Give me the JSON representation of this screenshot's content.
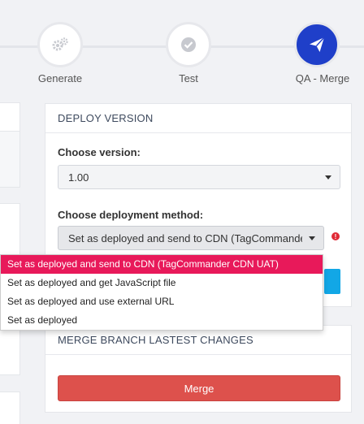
{
  "stepper": {
    "steps": [
      {
        "label": "Generate",
        "icon": "gears-icon",
        "state": "done"
      },
      {
        "label": "Test",
        "icon": "check-icon",
        "state": "done"
      },
      {
        "label": "QA - Merge",
        "icon": "paper-plane-icon",
        "state": "active"
      }
    ],
    "active_color": "#1f3fc9"
  },
  "deploy": {
    "title": "DEPLOY VERSION",
    "version_label": "Choose version:",
    "version_value": "1.00",
    "method_label": "Choose deployment method:",
    "method_value": "Set as deployed and send to CDN (TagCommander CDN UAT)",
    "info_icon": "!"
  },
  "dropdown": {
    "options": [
      "Set as deployed and send to CDN (TagCommander CDN UAT)",
      "Set as deployed and get JavaScript file",
      "Set as deployed and use external URL",
      "Set as deployed"
    ],
    "selected_index": 0,
    "highlight_color": "#e8195a"
  },
  "merge": {
    "title": "MERGE BRANCH LASTEST CHANGES",
    "button_label": "Merge",
    "button_color": "#dd514c"
  }
}
